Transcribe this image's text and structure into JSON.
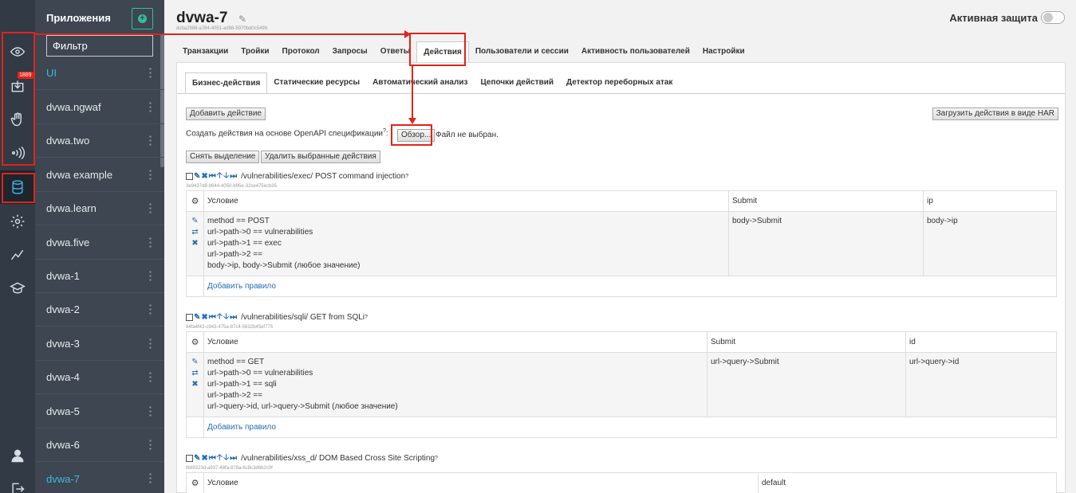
{
  "rail": {
    "badge": "1889",
    "icons": [
      "eye-icon",
      "download-icon",
      "hand-icon",
      "signal-icon",
      "database-icon",
      "settings-icon",
      "chart-icon",
      "graduation-icon",
      "user-icon",
      "logout-icon"
    ]
  },
  "apps": {
    "title": "Приложения",
    "filter_value": "Фильтр",
    "items": [
      "UI",
      "dvwa.ngwaf",
      "dvwa.two",
      "dvwa example",
      "dvwa.learn",
      "dvwa.five",
      "dvwa-1",
      "dvwa-2",
      "dvwa-3",
      "dvwa-4",
      "dvwa-5",
      "dvwa-6",
      "dvwa-7"
    ]
  },
  "header": {
    "title": "dvwa-7",
    "id": "dcba2988-a784-4051-ad98-5970bd0c5498",
    "protection_label": "Активная защита"
  },
  "tabs": [
    "Транзакции",
    "Тройки",
    "Протокол",
    "Запросы",
    "Ответы",
    "Действия",
    "Пользователи и сессии",
    "Активность пользователей",
    "Настройки"
  ],
  "subtabs": [
    "Бизнес-действия",
    "Статические ресурсы",
    "Автоматический анализ",
    "Цепочки действий",
    "Детектор переборных атак"
  ],
  "toolbar": {
    "add_action": "Добавить действие",
    "upload_har": "Загрузить действия в виде HAR",
    "openapi_label": "Создать действия на основе OpenAPI спецификации",
    "help_mark": "?",
    "colon": ":",
    "browse": "Обзор...",
    "no_file": "Файл не выбран.",
    "deselect": "Снять выделение",
    "delete_selected": "Удалить выбранные действия"
  },
  "actions": [
    {
      "title": "/vulnerabilities/exec/ POST command injection",
      "id": "3e9437d8-8644-4050-b95e-32ce475ecb35",
      "headers": [
        "Условие",
        "Submit",
        "ip"
      ],
      "conditions": [
        "method == POST",
        "url->path->0 == vulnerabilities",
        "url->path->1 == exec",
        "url->path->2 ==",
        "body->ip, body->Submit (любое значение)"
      ],
      "values": [
        "body->Submit",
        "body->ip"
      ],
      "add_rule": "Добавить правило"
    },
    {
      "title": "/vulnerabilities/sqli/ GET from SQLi",
      "id": "84fa4f43-c943-475a-87c4-5632b45ef775",
      "headers": [
        "Условие",
        "Submit",
        "id"
      ],
      "conditions": [
        "method == GET",
        "url->path->0 == vulnerabilities",
        "url->path->1 == sqli",
        "url->path->2 ==",
        "url->query->id, url->query->Submit (любое значение)"
      ],
      "values": [
        "url->query->Submit",
        "url->query->id"
      ],
      "add_rule": "Добавить правило"
    },
    {
      "title": "/vulnerabilities/xss_d/ DOM Based Cross Site Scripting",
      "id": "f4d9323d-a937-48fa-878a-6c8c3d6b2c0f",
      "headers": [
        "Условие",
        "default"
      ]
    }
  ]
}
